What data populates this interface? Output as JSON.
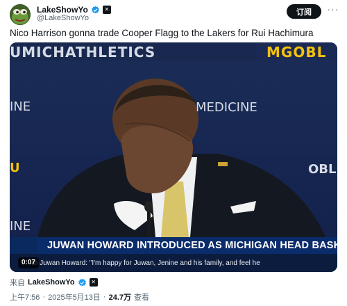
{
  "author": {
    "display_name": "LakeShowYo",
    "handle": "@LakeShowYo",
    "avatar_icon": "frog-avatar-icon",
    "verified_icon": "verified-badge-icon",
    "affiliate_icon": "x-affiliate-icon"
  },
  "header": {
    "subscribe_label": "订阅",
    "more_icon": "more-horizontal-icon"
  },
  "tweet": {
    "text": "Nico Harrison gonna trade Cooper Flagg to the Lakers for Rui Hachimura"
  },
  "video": {
    "wall_text_top": "UMICHATHLETICS",
    "wall_text_brand": "MGOBL",
    "wall_text_left_1": "INE",
    "wall_text_medicine": "MEDICINE",
    "wall_text_left_u": "U",
    "wall_text_right_obl": "OBL",
    "wall_text_left_2": "INE",
    "chyron": "JUWAN HOWARD INTRODUCED AS MICHIGAN HEAD BASKET",
    "caption": "m Juwan Howard: \"I'm happy for Juwan, Jenine and his family, and feel he",
    "timestamp": "0:07"
  },
  "footer": {
    "from_prefix": "来自",
    "from_name": "LakeShowYo",
    "time": "上午7:56",
    "date": "2025年5月13日",
    "separator": "·",
    "views_count": "24.7万",
    "views_label": "查看"
  },
  "colors": {
    "text_primary": "#0f1419",
    "text_secondary": "#536471",
    "verified_blue": "#1d9bf0",
    "button_bg": "#0f1419",
    "michigan_blue": "#0b2c6b",
    "maize": "#f4c20d"
  }
}
